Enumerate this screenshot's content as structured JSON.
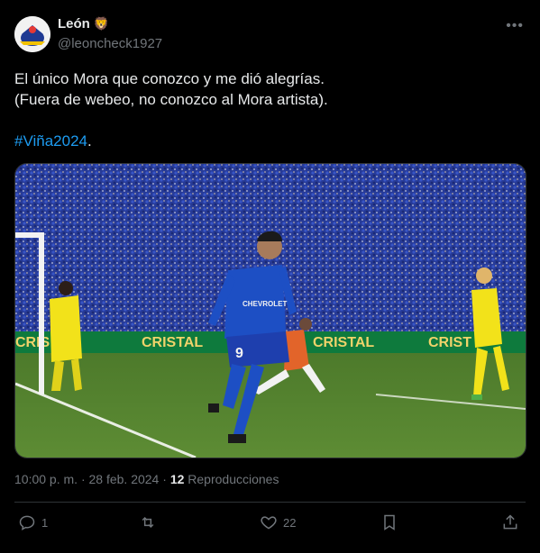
{
  "author": {
    "name": "León",
    "emoji": "🦁",
    "handle": "@leoncheck1927"
  },
  "tweet": {
    "line1": "El único Mora que conozco y me dió alegrías.",
    "line2": "(Fuera de webeo, no conozco al Mora artista).",
    "hashtag": "#Viña2024",
    "hashtag_suffix": "."
  },
  "media": {
    "board_text_1": "CRISTAL",
    "board_text_2": "CRISTAL",
    "board_text_3": "CRIST",
    "board_text_left": "CRIS",
    "jersey_number": "9",
    "sponsor": "CHEVROLET"
  },
  "meta": {
    "time": "10:00 p. m.",
    "date": "28 feb. 2024",
    "views_count": "12",
    "views_label": "Reproducciones"
  },
  "actions": {
    "replies": "1",
    "reposts": "",
    "likes": "22"
  },
  "colors": {
    "link": "#1d9bf0",
    "muted": "#71767b",
    "text": "#e7e9ea",
    "uchile_blue": "#1d4fc4"
  }
}
